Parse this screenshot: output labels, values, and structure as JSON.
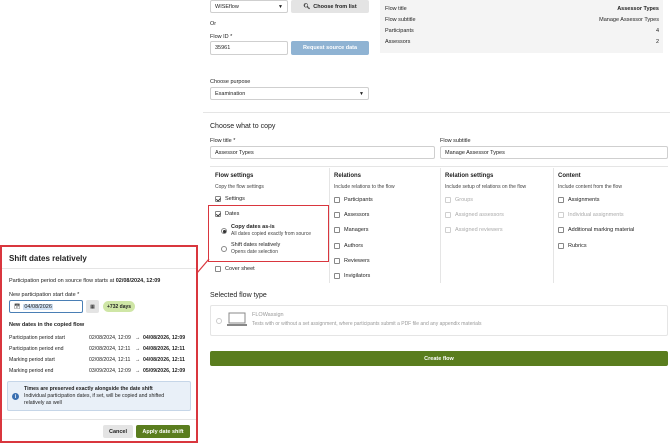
{
  "top": {
    "source_select": "WISEflow",
    "choose_from_list": "Choose from list",
    "or_label": "Or",
    "flow_id_label": "Flow ID *",
    "flow_id_value": "35961",
    "request_source_data": "Request source data",
    "choose_purpose_label": "Choose purpose",
    "purpose_value": "Examination"
  },
  "summary": {
    "rows": [
      {
        "key": "Flow title",
        "value": "Assessor Types"
      },
      {
        "key": "Flow subtitle",
        "value": "Manage Assessor Types"
      },
      {
        "key": "Participants",
        "value": "4"
      },
      {
        "key": "Assessors",
        "value": "2"
      }
    ]
  },
  "copy": {
    "heading": "Choose what to copy",
    "flow_title_label": "Flow title *",
    "flow_title_value": "Assessor Types",
    "flow_subtitle_label": "Flow subtitle",
    "flow_subtitle_value": "Manage Assessor Types",
    "flow_settings": {
      "title": "Flow settings",
      "subtitle": "Copy the flow settings",
      "settings": "Settings",
      "dates": "Dates",
      "copy_as_is": "Copy dates as-is",
      "copy_as_is_sub": "All dates copied exactly from source",
      "shift_rel": "Shift dates relatively",
      "shift_rel_sub": "Opens date selection",
      "cover_sheet": "Cover sheet"
    },
    "relations": {
      "title": "Relations",
      "subtitle": "Include relations to the flow",
      "items": [
        "Participants",
        "Assessors",
        "Managers",
        "Authors",
        "Reviewers",
        "Invigilators"
      ]
    },
    "relation_settings": {
      "title": "Relation settings",
      "subtitle": "Include setup of relations on the flow",
      "items": [
        "Groups",
        "Assigned assessors",
        "Assigned reviewers"
      ]
    },
    "content": {
      "title": "Content",
      "subtitle": "Include content from the flow",
      "items": [
        "Assignments",
        "Individual assignments",
        "Additional marking material",
        "Rubrics"
      ]
    }
  },
  "flow_type": {
    "heading": "Selected flow type",
    "name": "FLOWassign",
    "desc": "Tests with or without a set assignment, where participants submit a PDF file and any appendix materials"
  },
  "create_flow": "Create flow",
  "modal": {
    "title": "Shift dates relatively",
    "period_text": "Participation period on source flow starts at",
    "period_date": "02/08/2024, 12:09",
    "new_start_label": "New participation start date *",
    "new_start_value": "04/08/2026",
    "days_badge": "+732 days",
    "new_dates_heading": "New dates in the copied flow",
    "arrow": "→",
    "dates": [
      {
        "label": "Participation period start",
        "old": "02/08/2024, 12:09",
        "new": "04/08/2026, 12:09"
      },
      {
        "label": "Participation period end",
        "old": "02/08/2024, 12:11",
        "new": "04/08/2026, 12:11"
      },
      {
        "label": "Marking period start",
        "old": "02/08/2024, 12:11",
        "new": "04/08/2026, 12:11"
      },
      {
        "label": "Marking period end",
        "old": "03/09/2024, 12:09",
        "new": "05/09/2026, 12:09"
      }
    ],
    "info_title": "Times are preserved exactly alongside the date shift",
    "info_body": "Individual participation dates, if set, will be copied and shifted relatively as well",
    "cancel": "Cancel",
    "apply": "Apply date shift"
  },
  "colors": {
    "accent": "#5a7d1e",
    "highlight": "#d9363e",
    "badge": "#cfe6a6",
    "info_bg": "#e9f0f8"
  }
}
